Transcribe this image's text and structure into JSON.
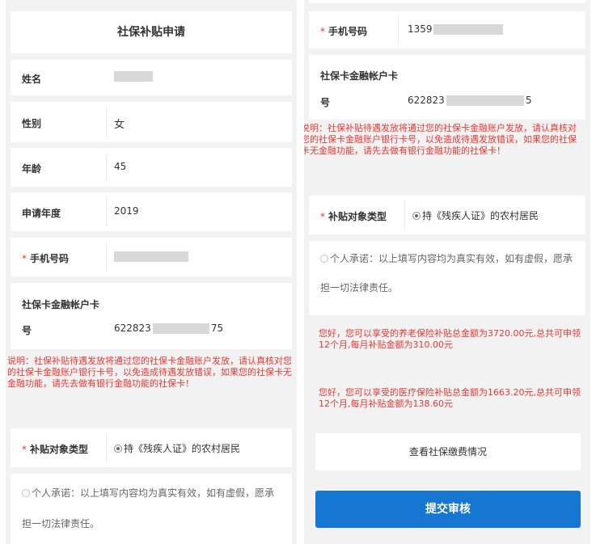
{
  "left": {
    "title": "社保补贴申请",
    "fields": {
      "name_label": "姓名",
      "gender_label": "性别",
      "gender_value": "女",
      "age_label": "年龄",
      "age_value": "45",
      "year_label": "申请年度",
      "year_value": "2019",
      "phone_label": "手机号码",
      "phone_required": "*",
      "account_label_line1": "社保卡金融帐户卡",
      "account_label_line2": "号",
      "account_prefix": "622823",
      "account_suffix": "75"
    },
    "notice": "说明：社保补贴待遇发放将通过您的社保卡金融账户发放，请认真核对您的社保卡金融账户银行卡号，以免造成待遇发放错误，如果您的社保卡无金融功能，请先去做有银行金融功能的社保卡！",
    "subsidy_label": "补贴对象类型",
    "subsidy_required": "*",
    "subsidy_option": "持《残疾人证》的农村居民",
    "promise_line1": "个人承诺：以上填写内容均为真实有效，如有虚假，愿承",
    "promise_line2": "担一切法律责任。"
  },
  "right": {
    "phone_label": "手机号码",
    "phone_required": "*",
    "phone_prefix": "1359",
    "account_label_line1": "社保卡金融帐户卡",
    "account_label_line2": "号",
    "account_prefix": "622823",
    "account_suffix": "5",
    "notice": "说明：社保补贴待遇发放将通过您的社保卡金融账户发放，请认真核对您的社保卡金融账户银行卡号，以免造成待遇发放错误，如果您的社保卡无金融功能，请先去做有银行金融功能的社保卡！",
    "subsidy_label": "补贴对象类型",
    "subsidy_required": "*",
    "subsidy_option": "持《残疾人证》的农村居民",
    "promise_line1": "个人承诺：以上填写内容均为真实有效，如有虚假，愿承",
    "promise_line2": "担一切法律责任。",
    "pension_msg": "您好，您可以享受的养老保险补贴总金额为3720.00元,总共可申领12个月,每月补贴金额为310.00元",
    "medical_msg": "您好，您可以享受的医疗保险补贴总金额为1663.20元,总共可申领12个月,每月补贴金额为138.60元",
    "view_button": "查看社保缴费情况",
    "submit_button": "提交审核"
  },
  "colors": {
    "accent": "#1677d2",
    "warning": "#e53935",
    "background": "#f2f2f2",
    "card": "#ffffff"
  }
}
